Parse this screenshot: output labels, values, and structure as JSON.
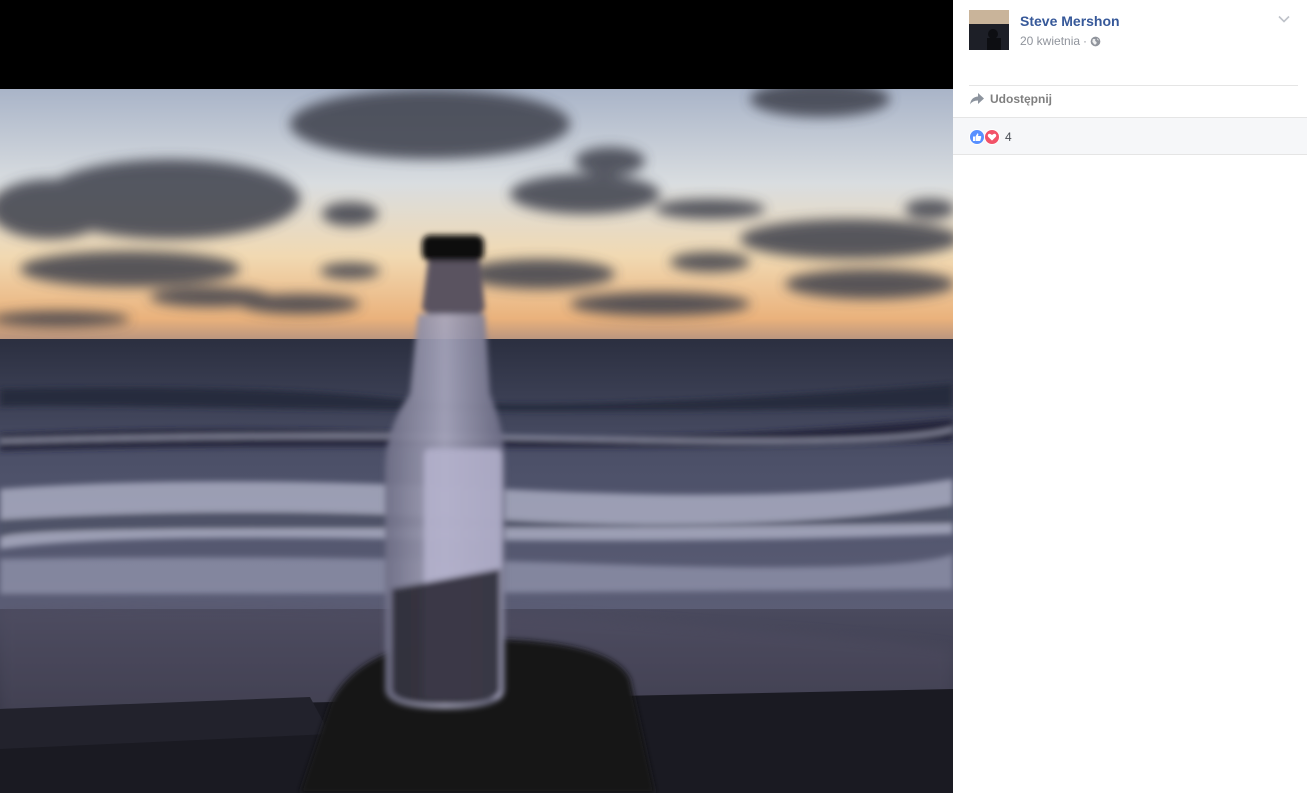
{
  "post": {
    "author": "Steve Mershon",
    "date": "20 kwietnia",
    "date_separator": "·",
    "privacy_icon": "globe-icon"
  },
  "actions": {
    "share_label": "Udostępnij",
    "share_icon": "share-arrow-icon"
  },
  "reactions": {
    "count": "4",
    "types": [
      "like",
      "love"
    ]
  },
  "colors": {
    "author_link": "#365899",
    "like": "#5890ff",
    "love": "#f25268",
    "viewer_bg": "#000000"
  }
}
